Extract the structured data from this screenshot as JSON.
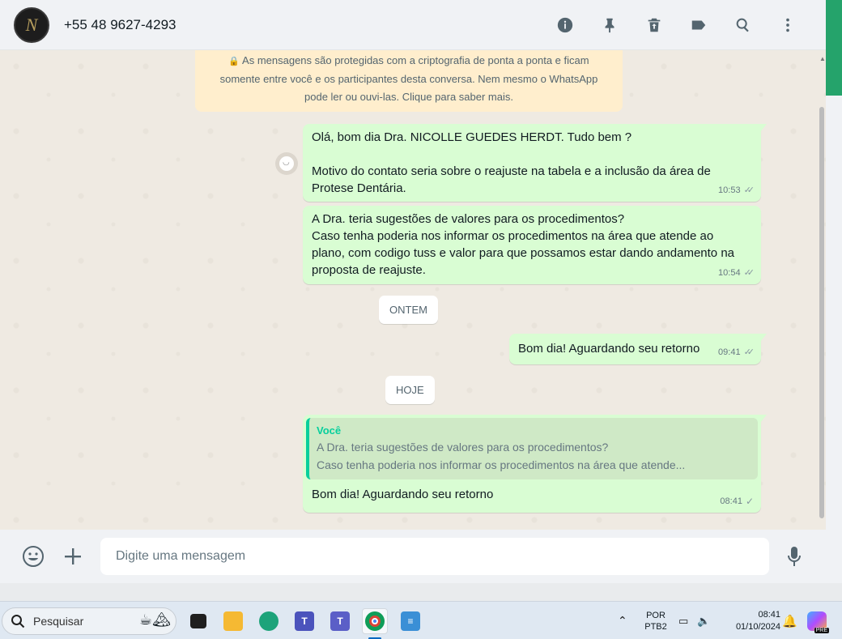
{
  "header": {
    "contact_name": "+55 48 9627-4293",
    "avatar_letter": "N",
    "icons": [
      "info-icon",
      "pin-icon",
      "delete-icon",
      "label-icon",
      "search-icon",
      "more-vertical-icon"
    ]
  },
  "encryption_notice": {
    "line1": "As mensagens são protegidas com a criptografia de ponta a ponta e ficam",
    "line2": "somente entre você e os participantes desta conversa. Nem mesmo o WhatsApp",
    "line3": "pode ler ou ouvi-las. Clique para saber mais."
  },
  "messages": [
    {
      "text": "Olá, bom dia Dra. NICOLLE GUEDES HERDT. Tudo bem ?\n\nMotivo do contato seria sobre o reajuste na tabela e a inclusão da área de\nProtese Dentária.",
      "time": "10:53",
      "status": "delivered"
    },
    {
      "text": "A Dra. teria sugestões de valores para os procedimentos?\nCaso tenha poderia nos informar os procedimentos na área que atende ao\nplano, com codigo tuss e valor para que possamos estar dando andamento na\nproposta de reajuste.",
      "time": "10:54",
      "status": "delivered"
    },
    {
      "text": "Bom dia! Aguardando seu retorno",
      "time": "09:41",
      "status": "delivered"
    },
    {
      "text": "Bom dia! Aguardando seu retorno",
      "time": "08:41",
      "status": "sent",
      "quote": {
        "author": "Você",
        "line1": "A Dra. teria sugestões de valores para os procedimentos?",
        "line2": "Caso tenha poderia nos informar os procedimentos na área que atende..."
      }
    }
  ],
  "date_chips": {
    "yesterday": "ONTEM",
    "today": "HOJE"
  },
  "composer": {
    "placeholder": "Digite uma mensagem"
  },
  "taskbar": {
    "search_label": "Pesquisar",
    "lang_line1": "POR",
    "lang_line2": "PTB2",
    "time": "08:41",
    "date": "01/10/2024",
    "copilot_badge": "PRE"
  },
  "colors": {
    "outgoing_bubble": "#d9fdd3",
    "chat_background": "#efeae2",
    "accent_green": "#06cf9c",
    "notice_background": "#ffeecd"
  }
}
